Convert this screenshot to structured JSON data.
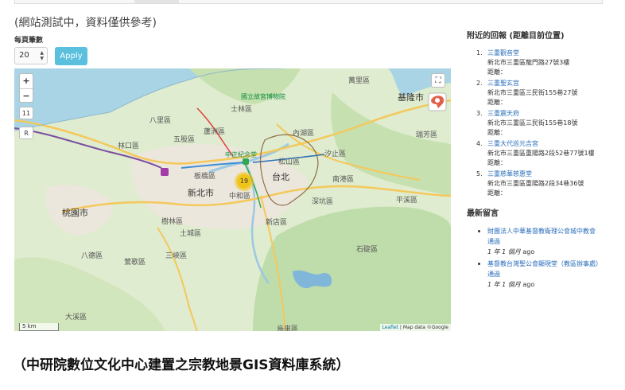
{
  "notice": "(網站測試中，資料僅供參考)",
  "per_page": {
    "label": "每頁筆數",
    "value": "20",
    "apply_label": "Apply"
  },
  "map": {
    "zoom_in": "+",
    "zoom_out": "−",
    "zoom_level": "11",
    "reset_label": "R",
    "fullscreen_icon": "fullscreen-icon",
    "cluster_count": "19",
    "scale_label": "5 km",
    "attribution_link": "Leaflet",
    "attribution_text": "| Map data ©Google",
    "labels": {
      "taoyuan": "桃園市",
      "newtaipei": "新北市",
      "taipei": "台北",
      "keelung": "基隆市",
      "museum": "國立故宮博物院",
      "cks": "中正紀念堂",
      "banqiao": "板橋區",
      "zhonghe": "中和區",
      "xindian": "新店區",
      "shulin": "樹林區",
      "sanxia": "三峽區",
      "bade": "八德區",
      "daxi": "大溪區",
      "xizhi": "汐止區",
      "pingxi": "平溪區",
      "shiding": "石碇區",
      "tucheng": "土城區",
      "yingge": "鶯歌區",
      "neihu": "內湖區",
      "shilin": "士林區",
      "wanli": "萬里區",
      "ruifang": "瑞芳區",
      "linkou": "林口區",
      "bali": "八里區",
      "wugu": "五股區",
      "luzhou": "蘆洲區",
      "songshan": "松山區",
      "nangang": "南港區",
      "shenkeng": "深坑區",
      "wulai": "烏來區"
    }
  },
  "caption": "（中研院數位文化中心建置之宗教地景GIS資料庫系統）",
  "sidebar": {
    "nearby_title": "附近的回報 (距離目前位置)",
    "nearby": [
      {
        "num": "1.",
        "name": "三重觀音堂",
        "address": "新北市三重區龍門路27號3樓",
        "distance": "距離："
      },
      {
        "num": "2.",
        "name": "三重聖玄宮",
        "address": "新北市三重區三民街155巷27號",
        "distance": "距離："
      },
      {
        "num": "3.",
        "name": "三重震天府",
        "address": "新北市三重區三民街155巷18號",
        "distance": "距離："
      },
      {
        "num": "4.",
        "name": "三重大代巡元吉宮",
        "address": "新北市三重區重陽路2段52巷77號1樓",
        "distance": "距離："
      },
      {
        "num": "5.",
        "name": "三重慈華慈惠堂",
        "address": "新北市三重區重陽路2段34巷36號",
        "distance": "距離："
      }
    ],
    "news_title": "最新留言",
    "news": [
      {
        "title": "財團法人中華基督教衛理公會城中教會",
        "status": "通過",
        "time": "1 年 1 個月",
        "ago": " ago"
      },
      {
        "title": "基督教台灣聖公會顯現堂（教區辦事處）",
        "status": "通過",
        "time": "1 年 1 個月",
        "ago": " ago"
      }
    ]
  }
}
